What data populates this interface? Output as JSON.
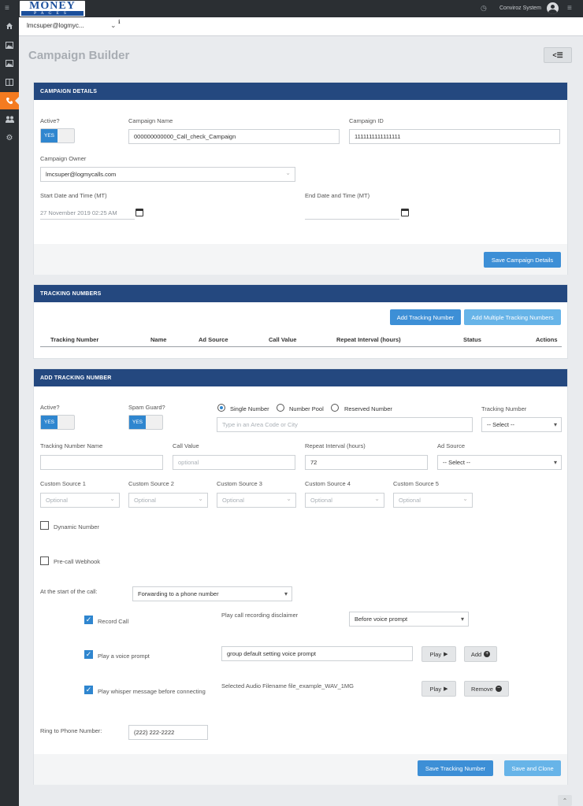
{
  "brand": {
    "logo_top": "MONEY",
    "logo_bottom": "PAGES"
  },
  "topbar": {
    "user_name": "Conviroz System"
  },
  "subbar": {
    "account_select": "lmcsuper@logmyc...",
    "info_glyph": "ℹ"
  },
  "page": {
    "title": "Campaign Builder"
  },
  "sidebar": {
    "items": [
      "menu-icon",
      "home-icon",
      "image-icon",
      "image-icon",
      "columns-icon",
      "phone-icon",
      "users-icon",
      "gear-icon"
    ]
  },
  "campaign_details": {
    "header": "CAMPAIGN DETAILS",
    "active_label": "Active?",
    "toggle_yes": "YES",
    "name_label": "Campaign Name",
    "name_value": "000000000000_Call_check_Campaign",
    "id_label": "Campaign ID",
    "id_value": "1111111111111111",
    "owner_label": "Campaign Owner",
    "owner_value": "lmcsuper@logmycalls.com",
    "start_label": "Start Date and Time (MT)",
    "start_value": "27 November 2019 02:25 AM",
    "end_label": "End Date and Time (MT)",
    "end_value": "",
    "save_button": "Save Campaign Details"
  },
  "tracking_numbers": {
    "header": "TRACKING NUMBERS",
    "add_button": "Add Tracking Number",
    "add_multiple_button": "Add Multiple Tracking Numbers",
    "columns": [
      "Tracking Number",
      "Name",
      "Ad Source",
      "Call Value",
      "Repeat Interval (hours)",
      "Status",
      "Actions"
    ]
  },
  "add_tracking": {
    "header": "ADD TRACKING NUMBER",
    "active_label": "Active?",
    "spam_label": "Spam Guard?",
    "toggle_yes": "YES",
    "radio_single": "Single Number",
    "radio_pool": "Number Pool",
    "radio_reserved": "Reserved Number",
    "area_placeholder": "Type in an Area Code or City",
    "tracking_number_label": "Tracking Number",
    "tracking_number_select": "-- Select --",
    "name_label": "Tracking Number Name",
    "name_value": "",
    "call_value_label": "Call Value",
    "call_value_placeholder": "optional",
    "repeat_label": "Repeat Interval (hours)",
    "repeat_value": "72",
    "ad_source_label": "Ad Source",
    "ad_source_select": "-- Select --",
    "custom_sources": [
      {
        "label": "Custom Source 1",
        "value": "Optional"
      },
      {
        "label": "Custom Source 2",
        "value": "Optional"
      },
      {
        "label": "Custom Source 3",
        "value": "Optional"
      },
      {
        "label": "Custom Source 4",
        "value": "Optional"
      },
      {
        "label": "Custom Source 5",
        "value": "Optional"
      }
    ],
    "dynamic_number_label": "Dynamic Number",
    "precall_label": "Pre-call Webhook",
    "start_call_label": "At the start of the call:",
    "start_call_select": "Forwarding to a phone number",
    "record_call_label": "Record Call",
    "disclaimer_label": "Play call recording disclaimer",
    "disclaimer_select": "Before voice prompt",
    "voice_prompt_label": "Play a voice prompt",
    "voice_prompt_value": "group default setting voice prompt",
    "play_button": "Play",
    "add_button": "Add",
    "whisper_label": "Play whisper message before connecting",
    "audio_filename": "Selected Audio Filename file_example_WAV_1MG",
    "remove_button": "Remove",
    "ring_label": "Ring to Phone Number:",
    "ring_value": "(222) 222-2222",
    "save_button": "Save Tracking Number",
    "save_clone_button": "Save and Clone"
  }
}
